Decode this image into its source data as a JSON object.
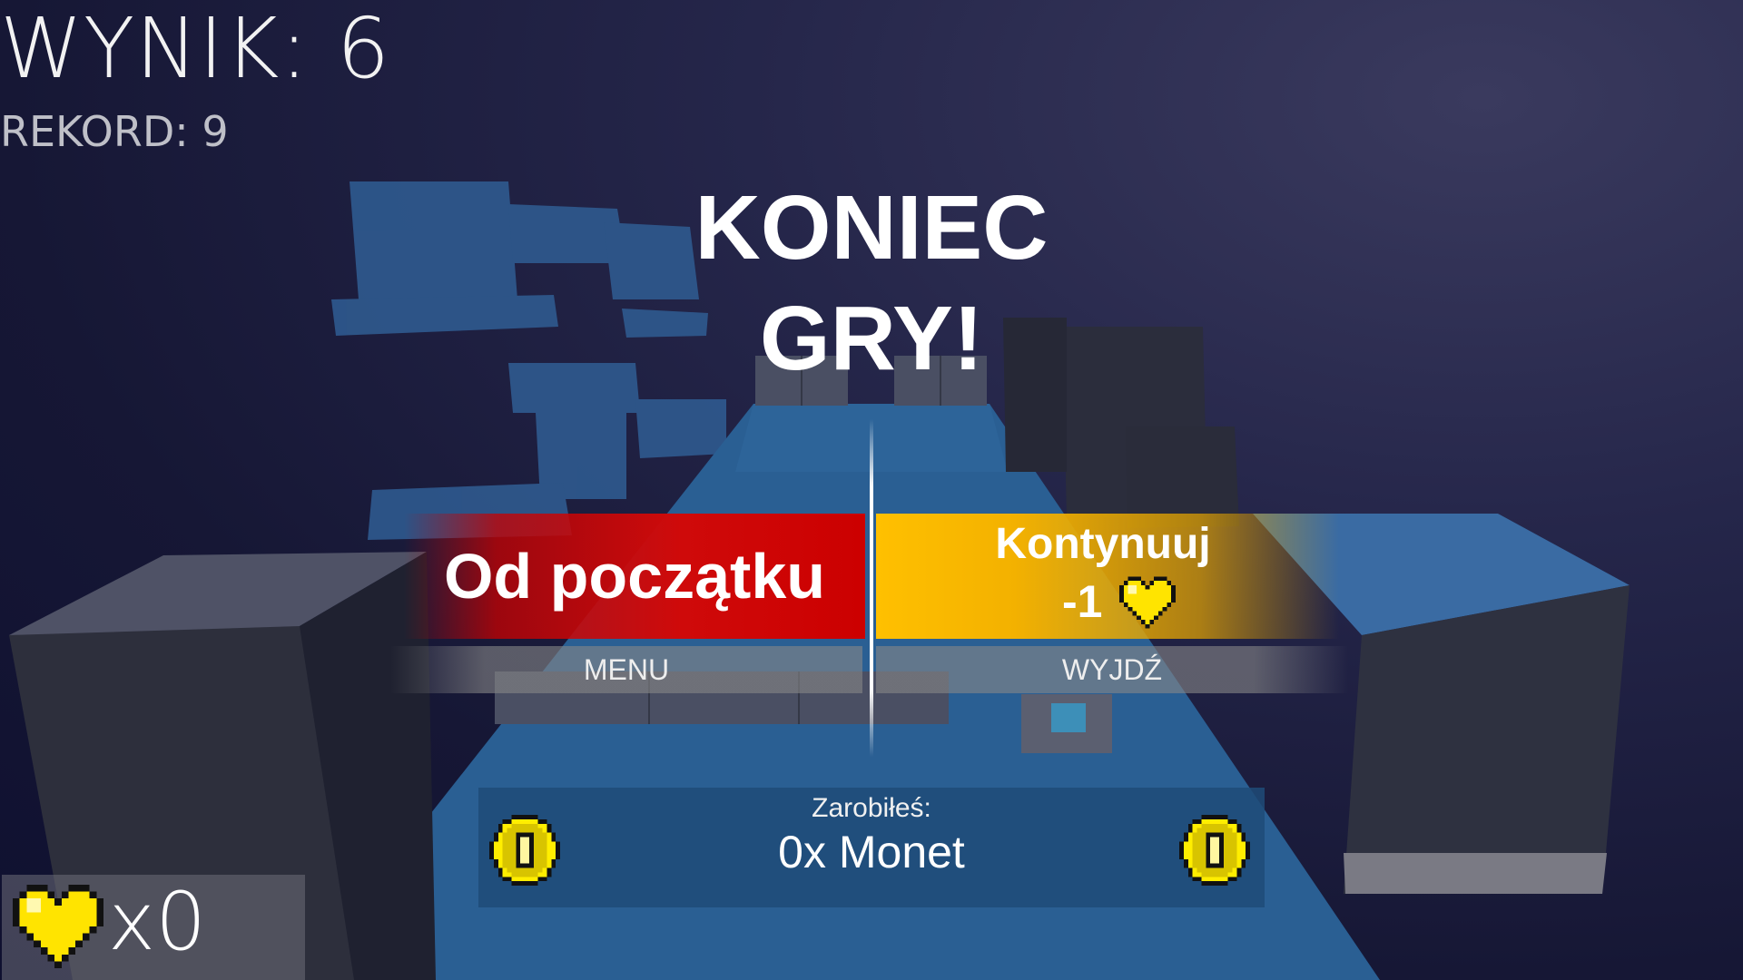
{
  "hud": {
    "score_text": "WYNIK: 6",
    "record_text": "REKORD: 9"
  },
  "game_over": {
    "title_line1": "KONIEC",
    "title_line2": "GRY!"
  },
  "buttons": {
    "restart_label": "Od początku",
    "continue_label": "Kontynuuj",
    "continue_cost": "-1",
    "menu_label": "MENU",
    "exit_label": "WYJDŹ"
  },
  "earnings": {
    "label": "Zarobiłeś:",
    "value": "0x Monet"
  },
  "lives": {
    "count_text": "x0"
  },
  "icons": {
    "heart": "heart-icon",
    "coin": "coin-icon"
  },
  "colors": {
    "restart": "#cc0000",
    "continue": "#ffc000",
    "panel": "#1e4b78",
    "heart": "#ffe400",
    "coin": "#ffee00"
  }
}
